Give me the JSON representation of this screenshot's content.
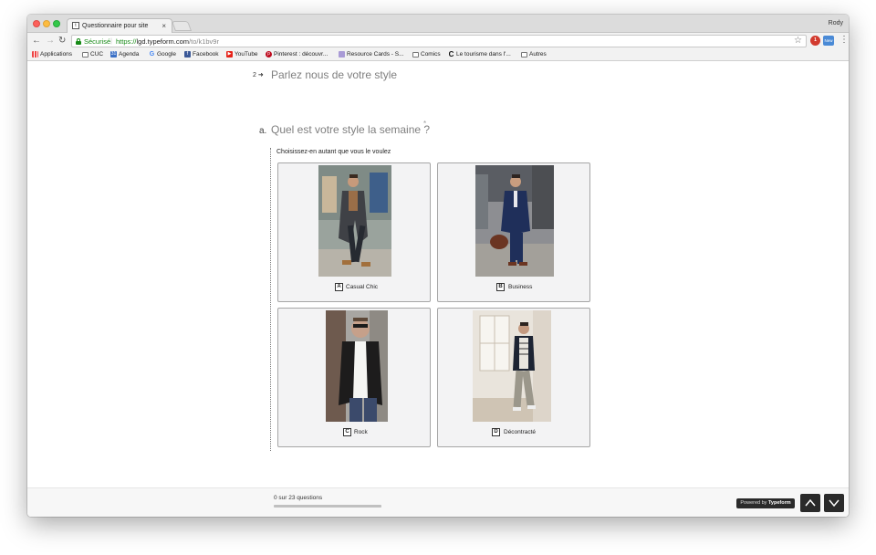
{
  "browser": {
    "tab_title": "Questionnaire pour site",
    "tab_favicon": "t",
    "close_glyph": "×",
    "profile": "Rody",
    "secure_label": "Sécurisé",
    "url_scheme": "https://",
    "url_host": "lgd.typeform.com",
    "url_path": "/to/k1bv9r",
    "ext1_label": "1",
    "ext2_label": "New",
    "bookmarks": [
      {
        "label": "Applications",
        "icon": "apps-grid-icon"
      },
      {
        "label": "CUC",
        "icon": "folder-icon"
      },
      {
        "label": "Agenda",
        "icon": "calendar-icon"
      },
      {
        "label": "Google",
        "icon": "google-icon"
      },
      {
        "label": "Facebook",
        "icon": "facebook-icon"
      },
      {
        "label": "YouTube",
        "icon": "youtube-icon"
      },
      {
        "label": "Pinterest : découvr...",
        "icon": "pinterest-icon"
      },
      {
        "label": "Resource Cards - S...",
        "icon": "resource-cards-icon"
      },
      {
        "label": "Comics",
        "icon": "folder-icon"
      },
      {
        "label": "Le tourisme dans l'...",
        "icon": "c-logo-icon"
      },
      {
        "label": "Autres",
        "icon": "folder-icon"
      }
    ]
  },
  "form": {
    "question_number": "2",
    "section_title": "Parlez nous de votre style",
    "question_letter": "a.",
    "question_text": "Quel est votre style la semaine ?",
    "required_mark": "*",
    "hint": "Choisissez-en autant que vous le voulez",
    "choices": [
      {
        "key": "A",
        "label": "Casual Chic"
      },
      {
        "key": "B",
        "label": "Business"
      },
      {
        "key": "C",
        "label": "Rock"
      },
      {
        "key": "D",
        "label": "Décontracté"
      }
    ]
  },
  "footer": {
    "progress_text": "0 sur 23 questions",
    "progress_fraction": 0.0,
    "powered_prefix": "Powered by",
    "powered_brand": "Typeform"
  },
  "colors": {
    "secure_green": "#168a16",
    "card_bg": "#f3f3f4",
    "question_gray": "#7f7f7f",
    "nav_dark": "#2a2a2a"
  }
}
